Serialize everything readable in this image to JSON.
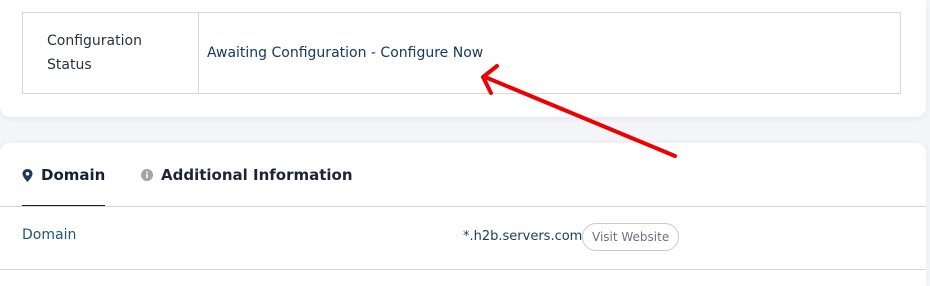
{
  "config": {
    "label": "Configuration Status",
    "value_text": "Awaiting Configuration - Configure Now"
  },
  "tabs": [
    {
      "label": "Domain",
      "icon": "map-pin-icon",
      "active": true
    },
    {
      "label": "Additional Information",
      "icon": "info-icon",
      "active": false
    }
  ],
  "domain_row": {
    "label": "Domain",
    "value": "*.h2b.servers.com",
    "button_label": "Visit Website"
  },
  "colors": {
    "annotation_arrow": "#ee0000",
    "link": "#153a63",
    "tab_active": "#14213d"
  }
}
